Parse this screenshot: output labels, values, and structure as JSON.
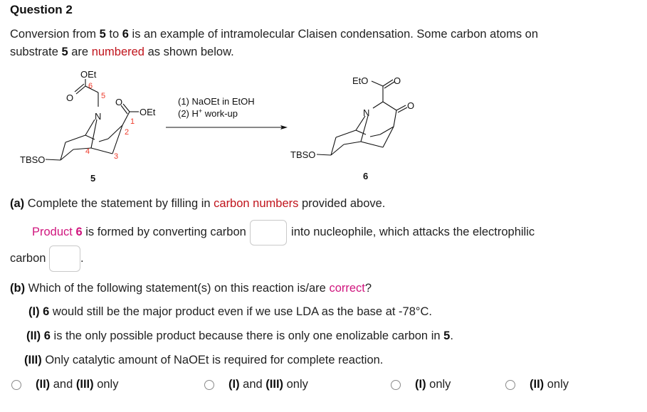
{
  "question": {
    "title": "Question 2",
    "intro": {
      "p1": "Conversion from ",
      "c5": "5",
      "p2": " to ",
      "c6": "6",
      "p3": " is an example of intramolecular Claisen condensation. Some carbon atoms on",
      "p4": "substrate ",
      "c5b": "5",
      "p5": " are ",
      "numbered": "numbered",
      "p6": " as shown below."
    }
  },
  "scheme": {
    "substrate": {
      "label": "5",
      "groups": {
        "oet_top": "OEt",
        "oet_right": "OEt",
        "o1": "O",
        "o2": "O",
        "n": "N",
        "tbso": "TBSO"
      },
      "carbon_numbers": [
        "1",
        "2",
        "3",
        "4",
        "5",
        "6"
      ]
    },
    "conditions": {
      "step1": "(1) NaOEt in EtOH",
      "step2_pre": "(2) H",
      "step2_sup": "+",
      "step2_post": " work-up"
    },
    "product": {
      "label": "6",
      "groups": {
        "eto": "EtO",
        "o_ester": "O",
        "o_ketone": "O",
        "n": "N",
        "tbso": "TBSO"
      }
    }
  },
  "part_a": {
    "label": "(a)",
    "text1": " Complete the statement by filling in ",
    "highlight": "carbon numbers",
    "text2": " provided above.",
    "statement": {
      "product_word": "Product ",
      "six": "6",
      "s1": " is formed by converting carbon",
      "s2": "into nucleophile, which attacks the electrophilic",
      "s3": "carbon",
      "s4": "."
    },
    "blank1_value": "",
    "blank2_value": ""
  },
  "part_b": {
    "label": "(b)",
    "text1": " Which of the following statement(s) on this reaction is/are ",
    "highlight": "correct",
    "text2": "?",
    "statements": [
      {
        "num": "(I)",
        "bold": " 6",
        "text": " would still be the major product even if we use LDA as the base at -78°C.",
        "tail_bold": "",
        "tail": ""
      },
      {
        "num": "(II)",
        "bold": " 6",
        "text": " is the only possible product because there is only one enolizable carbon in ",
        "tail_bold": "5",
        "tail": "."
      },
      {
        "num": "(III)",
        "bold": "",
        "text": " Only catalytic amount of NaOEt is required for complete reaction.",
        "tail_bold": "",
        "tail": ""
      }
    ],
    "options": [
      {
        "a": "(II)",
        "mid": " and ",
        "b": "(III)",
        "end": " only",
        "selected": false
      },
      {
        "a": "(I)",
        "mid": " and ",
        "b": "(III)",
        "end": " only",
        "selected": false
      },
      {
        "a": "(I)",
        "mid": "",
        "b": "",
        "end": " only",
        "selected": false
      },
      {
        "a": "(II)",
        "mid": "",
        "b": "",
        "end": " only",
        "selected": false
      }
    ]
  },
  "colors": {
    "highlight_red": "#c0141c",
    "highlight_pink": "#d0167e",
    "carbon_number_orange": "#ee3a2a"
  }
}
